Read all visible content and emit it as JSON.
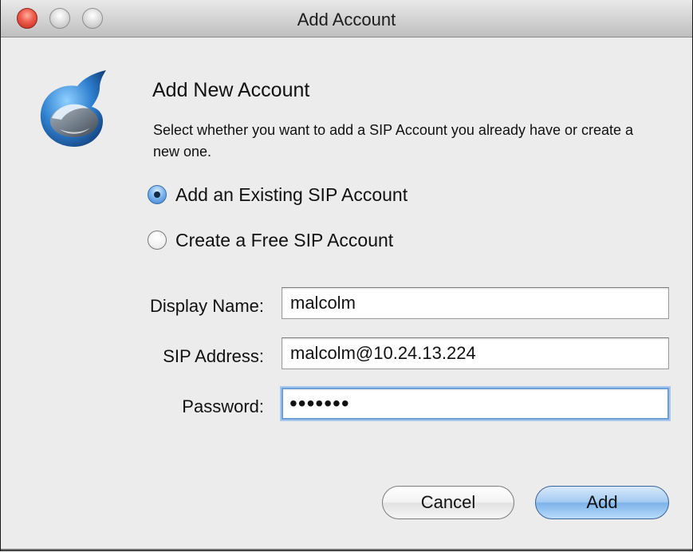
{
  "window": {
    "title": "Add Account",
    "close_color": "#e2473c"
  },
  "app": {
    "icon_name": "blink-app-icon",
    "icon_colors": [
      "#5aa9e8",
      "#1c5ea8",
      "#6b6b6b"
    ]
  },
  "header": {
    "title": "Add New Account",
    "description": "Select whether you want to add a SIP Account you already have or create a new one."
  },
  "account_type": {
    "options": [
      {
        "label": "Add an Existing SIP Account",
        "selected": true
      },
      {
        "label": "Create a Free SIP Account",
        "selected": false
      }
    ]
  },
  "form": {
    "display_name": {
      "label": "Display Name:",
      "value": "malcolm"
    },
    "sip_address": {
      "label": "SIP Address:",
      "value": "malcolm@10.24.13.224"
    },
    "password": {
      "label": "Password:",
      "value": "•••••••"
    }
  },
  "buttons": {
    "cancel_label": "Cancel",
    "add_label": "Add",
    "default_color": "#8dbcec"
  }
}
